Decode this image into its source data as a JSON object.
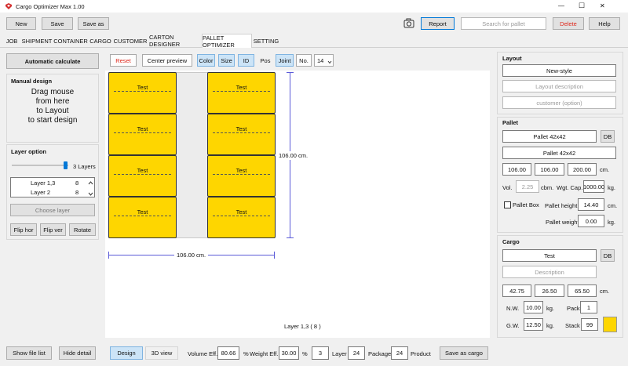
{
  "window": {
    "title": "Cargo Optimizer Max 1.00",
    "minimize": "—",
    "maximize": "☐",
    "close": "✕"
  },
  "toolbar": {
    "new": "New",
    "save": "Save",
    "save_as": "Save as",
    "report": "Report",
    "search_placeholder": "Search for pallet",
    "delete": "Delete",
    "help": "Help"
  },
  "tabs": [
    "JOB",
    "SHIPMENT",
    "CONTAINER",
    "CARGO",
    "CUSTOMER",
    "CARTON DESIGNER",
    "PALLET OPTIMIZER",
    "SETTING"
  ],
  "active_tab": "PALLET OPTIMIZER",
  "left": {
    "auto_calc": "Automatic calculate",
    "manual_title": "Manual design",
    "manual_text": [
      "Drag mouse",
      "from here",
      "to Layout",
      "to start design"
    ],
    "layer_title": "Layer option",
    "layers_count": "3 Layers",
    "slider_level": 1.0,
    "layer_list": [
      {
        "name": "Layer 1,3",
        "count": "8"
      },
      {
        "name": "Layer 2",
        "count": "8"
      }
    ],
    "choose_layer": "Choose layer",
    "flip_hor": "Flip hor",
    "flip_ver": "Flip ver",
    "rotate": "Rotate",
    "show_file_list": "Show file list",
    "hide_detail": "Hide detail"
  },
  "canvas_toolbar": {
    "reset": "Reset",
    "center": "Center preview",
    "color": "Color",
    "size": "Size",
    "id": "ID",
    "pos": "Pos",
    "joint": "Joint",
    "no": "No.",
    "no_value": "14"
  },
  "layout": {
    "boxes": [
      {
        "label": "Test",
        "col": 0,
        "row": 0
      },
      {
        "label": "Test",
        "col": 0,
        "row": 1
      },
      {
        "label": "Test",
        "col": 0,
        "row": 2
      },
      {
        "label": "Test",
        "col": 0,
        "row": 3
      },
      {
        "label": "Test",
        "col": 1,
        "row": 0
      },
      {
        "label": "Test",
        "col": 1,
        "row": 1
      },
      {
        "label": "Test",
        "col": 1,
        "row": 2
      },
      {
        "label": "Test",
        "col": 1,
        "row": 3
      }
    ],
    "dim_height": "106.00 cm.",
    "dim_width": "106.00 cm.",
    "layer_caption": "Layer 1,3 ( 8 )"
  },
  "bottom": {
    "design": "Design",
    "view3d": "3D view",
    "vol_eff_label": "Volume Eff.",
    "vol_eff": "80.66",
    "pct1": "%",
    "wgt_eff_label": "Weight Eff.",
    "wgt_eff": "30.00",
    "pct2": "%",
    "layer_val": "3",
    "layer_label": "Layer",
    "package_val": "24",
    "package_label": "Package",
    "product_val": "24",
    "product_label": "Product",
    "save_as_cargo": "Save as cargo"
  },
  "right": {
    "layout_title": "Layout",
    "layout_name": "New-style",
    "layout_desc": "Layout description",
    "layout_customer": "customer (option)",
    "pallet_title": "Pallet",
    "pallet_name": "Pallet 42x42",
    "db": "DB",
    "pallet_name2": "Pallet 42x42",
    "pallet_l": "106.00",
    "pallet_w": "106.00",
    "pallet_h": "200.00",
    "cm": "cm.",
    "vol_label": "Vol.",
    "vol_value": "2.25",
    "cbm": "cbm.",
    "wgt_cap_label": "Wgt. Cap.",
    "wgt_cap": "1000.00",
    "kg": "kg.",
    "pallet_box": "Pallet Box",
    "pallet_height_label": "Pallet height",
    "pallet_height": "14.40",
    "pallet_weight_label": "Pallet weight",
    "pallet_weight": "0.00",
    "cargo_title": "Cargo",
    "cargo_name": "Test",
    "cargo_desc": "Description",
    "cargo_l": "42.75",
    "cargo_w": "26.50",
    "cargo_h": "65.50",
    "nw_label": "N.W.",
    "nw": "10.00",
    "pack_label": "Pack",
    "pack": "1",
    "gw_label": "G.W.",
    "gw": "12.50",
    "stack_label": "Stack",
    "stack": "99",
    "cargo_color": "#fed600"
  }
}
